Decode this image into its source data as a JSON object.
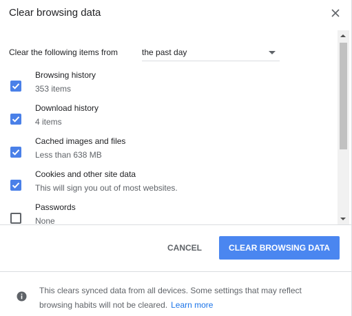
{
  "dialog": {
    "title": "Clear browsing data"
  },
  "time_range": {
    "label": "Clear the following items from",
    "selected": "the past day"
  },
  "items": [
    {
      "label": "Browsing history",
      "detail": "353 items",
      "checked": true
    },
    {
      "label": "Download history",
      "detail": "4 items",
      "checked": true
    },
    {
      "label": "Cached images and files",
      "detail": "Less than 638 MB",
      "checked": true
    },
    {
      "label": "Cookies and other site data",
      "detail": "This will sign you out of most websites.",
      "checked": true
    },
    {
      "label": "Passwords",
      "detail": "None",
      "checked": false
    }
  ],
  "buttons": {
    "cancel": "CANCEL",
    "clear": "CLEAR BROWSING DATA"
  },
  "footer": {
    "text": "This clears synced data from all devices. Some settings that may reflect browsing habits will not be cleared.",
    "link": "Learn more"
  },
  "colors": {
    "accent": "#4a86f0",
    "checkbox": "#4a80e8",
    "link": "#1a73e8"
  },
  "icons": {
    "close": "close-icon",
    "info": "info-icon",
    "check": "check-icon",
    "dropdown": "chevron-down-icon"
  }
}
